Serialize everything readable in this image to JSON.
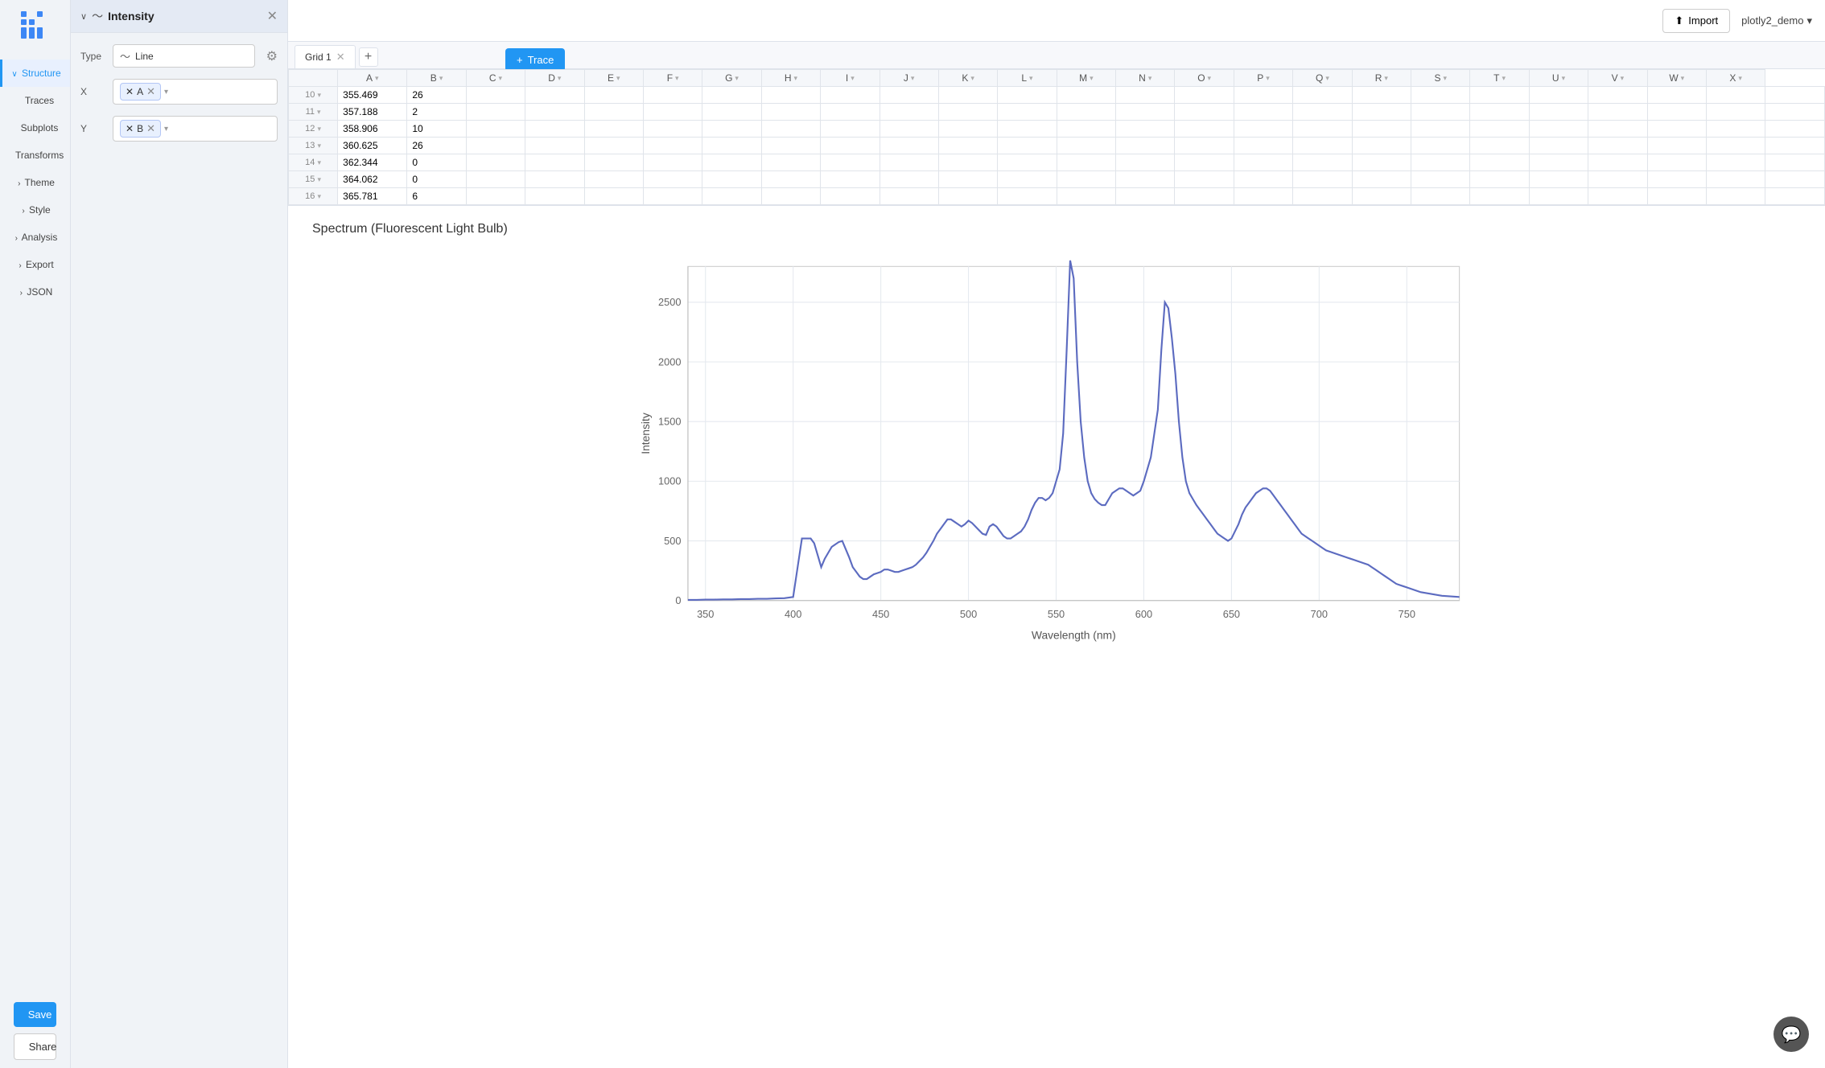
{
  "app": {
    "logo_text": "plotly",
    "user": "plotly2_demo",
    "user_arrow": "▾"
  },
  "topbar": {
    "import_label": "Import",
    "import_icon": "↑",
    "add_trace_label": "+ Trace"
  },
  "sidebar": {
    "nav_items": [
      {
        "id": "structure",
        "label": "Structure",
        "arrow": "∨",
        "active": true
      },
      {
        "id": "traces",
        "label": "Traces",
        "active": false
      },
      {
        "id": "subplots",
        "label": "Subplots",
        "active": false
      },
      {
        "id": "transforms",
        "label": "Transforms",
        "active": false
      },
      {
        "id": "theme",
        "label": "Theme",
        "arrow": "›",
        "active": false
      },
      {
        "id": "style",
        "label": "Style",
        "arrow": "›",
        "active": false
      },
      {
        "id": "analysis",
        "label": "Analysis",
        "arrow": "›",
        "active": false
      },
      {
        "id": "export",
        "label": "Export",
        "arrow": "›",
        "active": false
      },
      {
        "id": "json",
        "label": "JSON",
        "arrow": "›",
        "active": false
      }
    ],
    "save_label": "Save",
    "share_label": "Share"
  },
  "panel": {
    "title": "Intensity",
    "chevron": "∨",
    "close": "✕",
    "type_label": "Type",
    "type_value": "Line",
    "type_icon": "〜",
    "x_label": "X",
    "x_value": "A",
    "y_label": "Y",
    "y_value": "B"
  },
  "grid": {
    "tab_name": "Grid 1",
    "columns": [
      "",
      "A",
      "B",
      "C",
      "D",
      "E",
      "F",
      "G",
      "H",
      "I",
      "J",
      "K",
      "L",
      "M",
      "N",
      "O",
      "P",
      "Q",
      "R",
      "S",
      "T",
      "U",
      "V",
      "W",
      "X"
    ],
    "rows": [
      {
        "num": 10,
        "a": "355.469",
        "b": "26"
      },
      {
        "num": 11,
        "a": "357.188",
        "b": "2"
      },
      {
        "num": 12,
        "a": "358.906",
        "b": "10"
      },
      {
        "num": 13,
        "a": "360.625",
        "b": "26"
      },
      {
        "num": 14,
        "a": "362.344",
        "b": "0"
      },
      {
        "num": 15,
        "a": "364.062",
        "b": "0"
      },
      {
        "num": 16,
        "a": "365.781",
        "b": "6"
      }
    ]
  },
  "chart": {
    "title": "Spectrum (Fluorescent Light Bulb)",
    "x_label": "Wavelength (nm)",
    "y_label": "Intensity",
    "y_ticks": [
      "0",
      "500",
      "1000",
      "1500",
      "2000",
      "2500"
    ],
    "x_ticks": [
      "350",
      "400",
      "450",
      "500",
      "550",
      "600",
      "650",
      "700",
      "750"
    ],
    "line_color": "#5c6bc0"
  }
}
